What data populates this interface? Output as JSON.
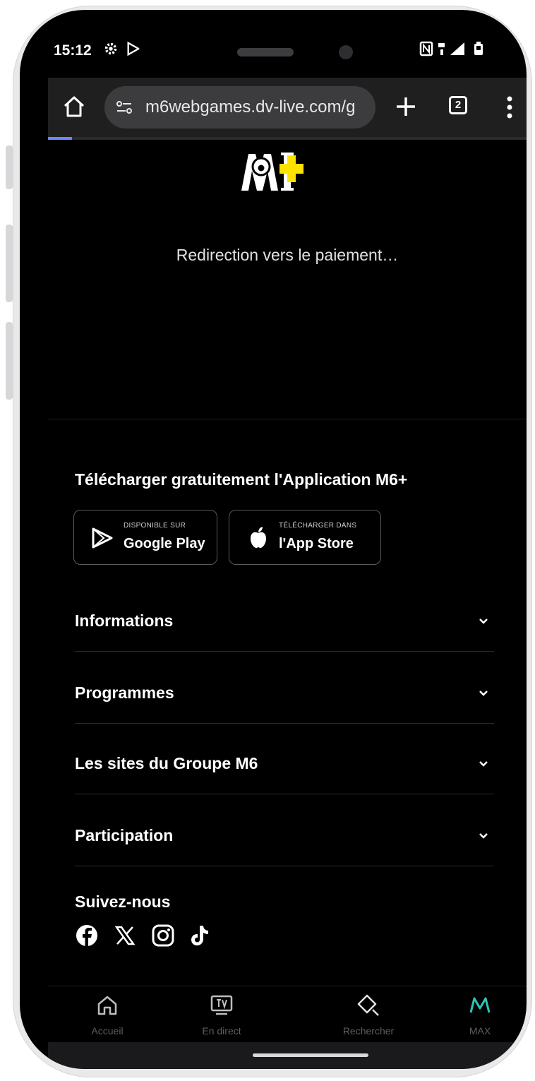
{
  "status_bar": {
    "time": "15:12",
    "icons": [
      "settings-icon",
      "play-store-icon",
      "nfc-icon",
      "5g-icon",
      "signal-icon",
      "battery-icon"
    ]
  },
  "browser": {
    "url": "m6webgames.dv-live.com/g",
    "tab_count": "2",
    "load_progress": 0.05
  },
  "page": {
    "logo_text": "M6+",
    "redirect_text": "Redirection vers le paiement…",
    "download_title": "Télécharger gratuitement l'Application M6+",
    "stores": [
      {
        "small": "DISPONIBLE SUR",
        "big": "Google Play",
        "icon": "google-play-icon"
      },
      {
        "small": "TÉLÉCHARGER DANS",
        "big": "l'App Store",
        "icon": "apple-icon"
      }
    ],
    "accordion": [
      {
        "label": "Informations"
      },
      {
        "label": "Programmes"
      },
      {
        "label": "Les sites du Groupe M6"
      },
      {
        "label": "Participation"
      }
    ],
    "follow_title": "Suivez-nous",
    "social": [
      "facebook-icon",
      "x-icon",
      "instagram-icon",
      "tiktok-icon"
    ]
  },
  "bottom_nav": [
    {
      "label": "Accueil",
      "icon": "home-icon"
    },
    {
      "label": "En direct",
      "icon": "tv-icon"
    },
    {
      "label": "Rechercher",
      "icon": "search-icon"
    },
    {
      "label": "MAX",
      "icon": "max-icon",
      "active": true
    }
  ],
  "colors": {
    "background": "#000000",
    "accent_teal": "#2fc4b4",
    "logo_yellow": "#ffe100"
  }
}
